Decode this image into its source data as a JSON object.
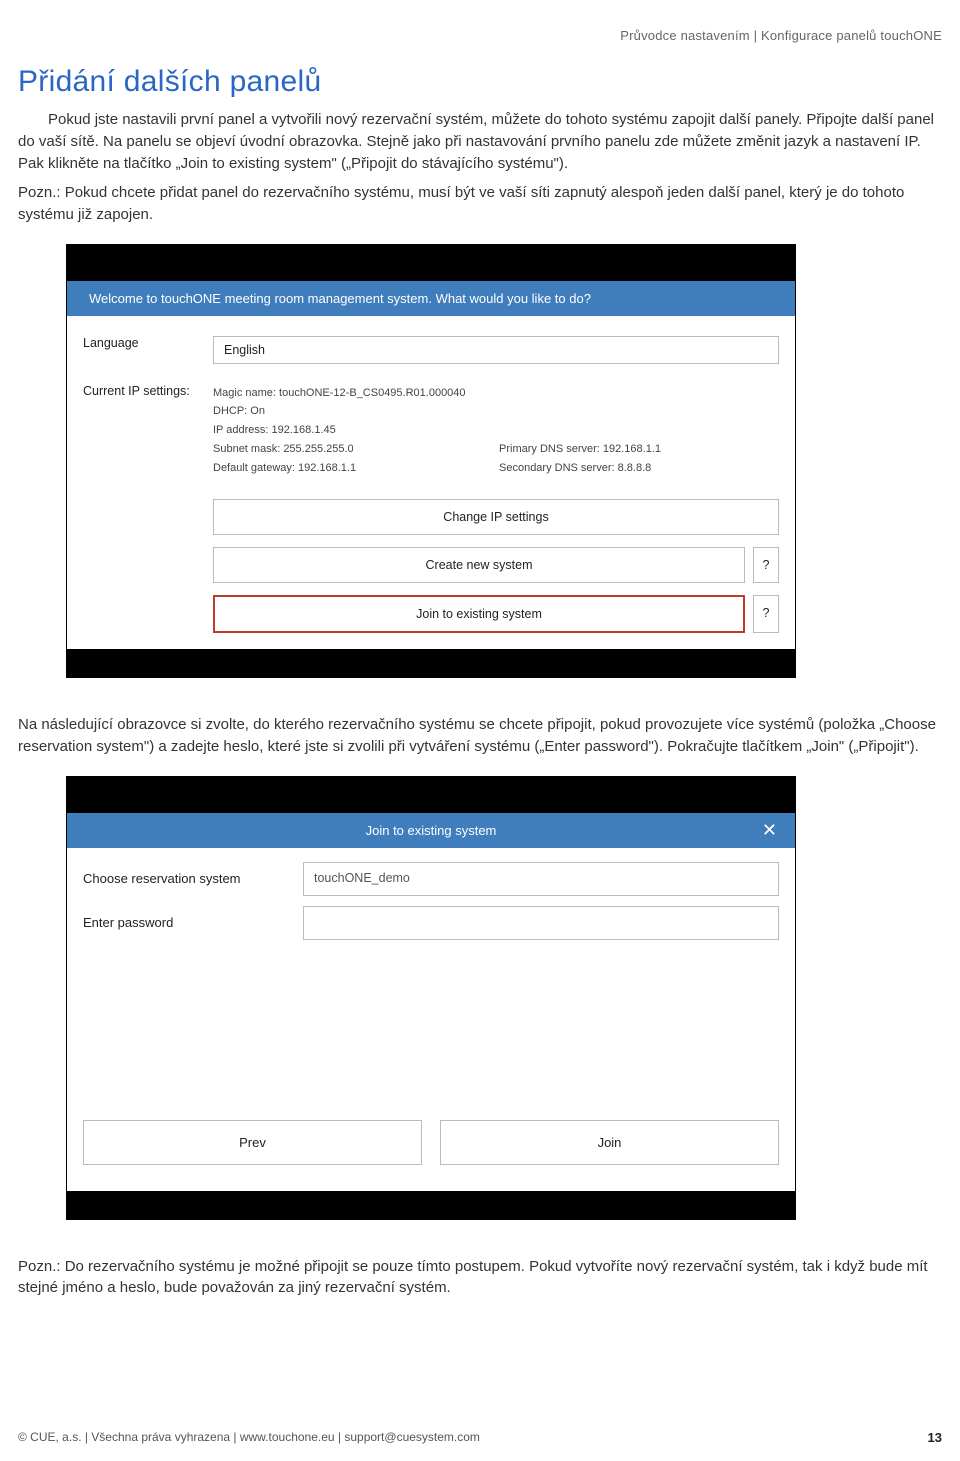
{
  "header": {
    "breadcrumb": "Průvodce nastavením | Konfigurace panelů touchONE"
  },
  "title": "Přidání dalších panelů",
  "para1": "Pokud jste nastavili první panel a vytvořili nový rezervační systém, můžete do tohoto systému zapojit další panely. Připojte další panel do vaší sítě. Na panelu se objeví úvodní obrazovka. Stejně jako při nastavování prvního panelu zde můžete změnit jazyk a nastavení IP. Pak klikněte na tlačítko „Join to existing system\" („Připojit do stávajícího systému\").",
  "para2": "Pozn.: Pokud chcete přidat panel do rezervačního systému, musí být ve vaší síti zapnutý alespoň jeden další panel, který je do tohoto systému již zapojen.",
  "screen1": {
    "banner": "Welcome to touchONE meeting room management system. What would you like to do?",
    "lang_label": "Language",
    "lang_value": "English",
    "ip_label": "Current IP settings:",
    "ip": {
      "magic": "Magic name: touchONE-12-B_CS0495.R01.000040",
      "dhcp": "DHCP: On",
      "addr": "IP address: 192.168.1.45",
      "mask_k": "Subnet mask: 255.255.255.0",
      "pdns": "Primary DNS server: 192.168.1.1",
      "gw_k": "Default gateway: 192.168.1.1",
      "sdns": "Secondary DNS server: 8.8.8.8"
    },
    "btn_changeip": "Change IP settings",
    "btn_create": "Create new system",
    "btn_join": "Join to existing system",
    "q": "?"
  },
  "para3": "Na následující obrazovce si zvolte, do kterého rezervačního systému se chcete připojit, pokud provozujete více systémů (položka „Choose reservation system\") a zadejte heslo, které jste si zvolili při vytváření systému („Enter password\"). Pokračujte tlačítkem „Join\" („Připojit\").",
  "screen2": {
    "banner": "Join to existing system",
    "close": "✕",
    "choose_label": "Choose reservation system",
    "choose_value": "touchONE_demo",
    "pwd_label": "Enter password",
    "pwd_value": "",
    "prev": "Prev",
    "join": "Join"
  },
  "para4": "Pozn.: Do rezervačního systému je možné připojit se pouze tímto postupem. Pokud vytvoříte nový rezervační systém, tak i když bude mít stejné jméno a heslo, bude považován za jiný rezervační systém.",
  "footer": {
    "left": "© CUE, a.s. | Všechna práva vyhrazena | www.touchone.eu | support@cuesystem.com",
    "page": "13"
  }
}
